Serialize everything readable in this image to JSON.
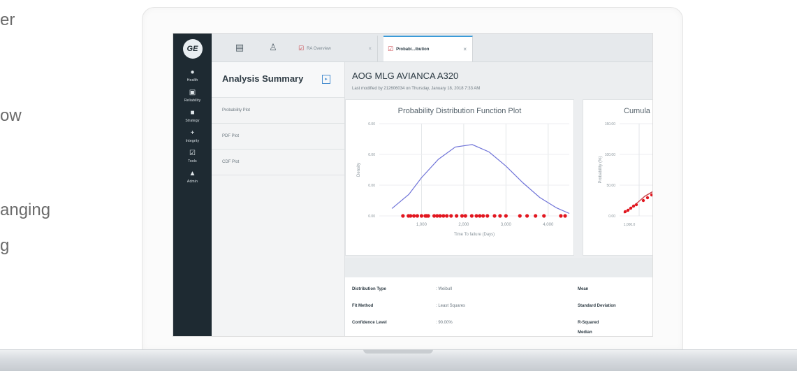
{
  "left_text": [
    "er",
    "ow",
    "anging",
    "g"
  ],
  "nav": {
    "logo": "GE",
    "items": [
      {
        "icon": "●",
        "label": "Health"
      },
      {
        "icon": "▣",
        "label": "Reliability"
      },
      {
        "icon": "■",
        "label": "Strategy"
      },
      {
        "icon": "+",
        "label": "Integrity"
      },
      {
        "icon": "☑",
        "label": "Tools"
      },
      {
        "icon": "▲",
        "label": "Admin"
      }
    ]
  },
  "tabs": {
    "overview": "RA Overview",
    "active": "Probabi...ibution",
    "close": "×"
  },
  "panel": {
    "title": "Analysis Summary",
    "items": [
      "Probability Plot",
      "PDF Plot",
      "CDF Plot"
    ]
  },
  "main": {
    "asset_title": "AOG MLG AVIANCA A320",
    "modified": "Last modified by 212606034 on Thursday, January 18, 2018 7:33 AM"
  },
  "chart_data": [
    {
      "type": "line",
      "title": "Probability Distribution Function Plot",
      "xlabel": "Time To failure (Days)",
      "ylabel": "Density",
      "xlim": [
        0,
        4500
      ],
      "ylim": [
        0,
        0.015
      ],
      "x_ticks": [
        "1,000",
        "2,000",
        "3,000",
        "4,000"
      ],
      "y_ticks": [
        "0.00",
        "0.00",
        "0.00",
        "0.00"
      ],
      "series": [
        {
          "x": [
            300,
            700,
            1000,
            1400,
            1800,
            2200,
            2600,
            3000,
            3400,
            3800,
            4200,
            4600
          ],
          "y": [
            0.0012,
            0.0035,
            0.0062,
            0.0092,
            0.0112,
            0.0116,
            0.0104,
            0.0081,
            0.0054,
            0.003,
            0.0013,
            0.0004
          ]
        }
      ],
      "failure_points_x": [
        560,
        690,
        740,
        820,
        900,
        1000,
        1090,
        1120,
        1160,
        1300,
        1370,
        1440,
        1520,
        1600,
        1700,
        1830,
        1960,
        2040,
        2190,
        2300,
        2380,
        2460,
        2560,
        2730,
        2860,
        3000,
        3330,
        3500,
        3700,
        3900,
        4300,
        4500
      ]
    },
    {
      "type": "line",
      "title": "Cumula",
      "ylabel": "Probability (%)",
      "y_ticks": [
        "150.00",
        "100.00",
        "50.00",
        "0.00"
      ],
      "x_ticks": [
        "1,000.0"
      ]
    }
  ],
  "stats": {
    "rows": [
      {
        "label": "Distribution Type",
        "value": ": Weibull"
      },
      {
        "label": "Fit Method",
        "value": ": Least Squares"
      },
      {
        "label": "Confidence Level",
        "value": ": 90.00%"
      }
    ],
    "right_labels": [
      "Mean",
      "Standard Deviation",
      "R-Squared",
      "Median"
    ]
  }
}
